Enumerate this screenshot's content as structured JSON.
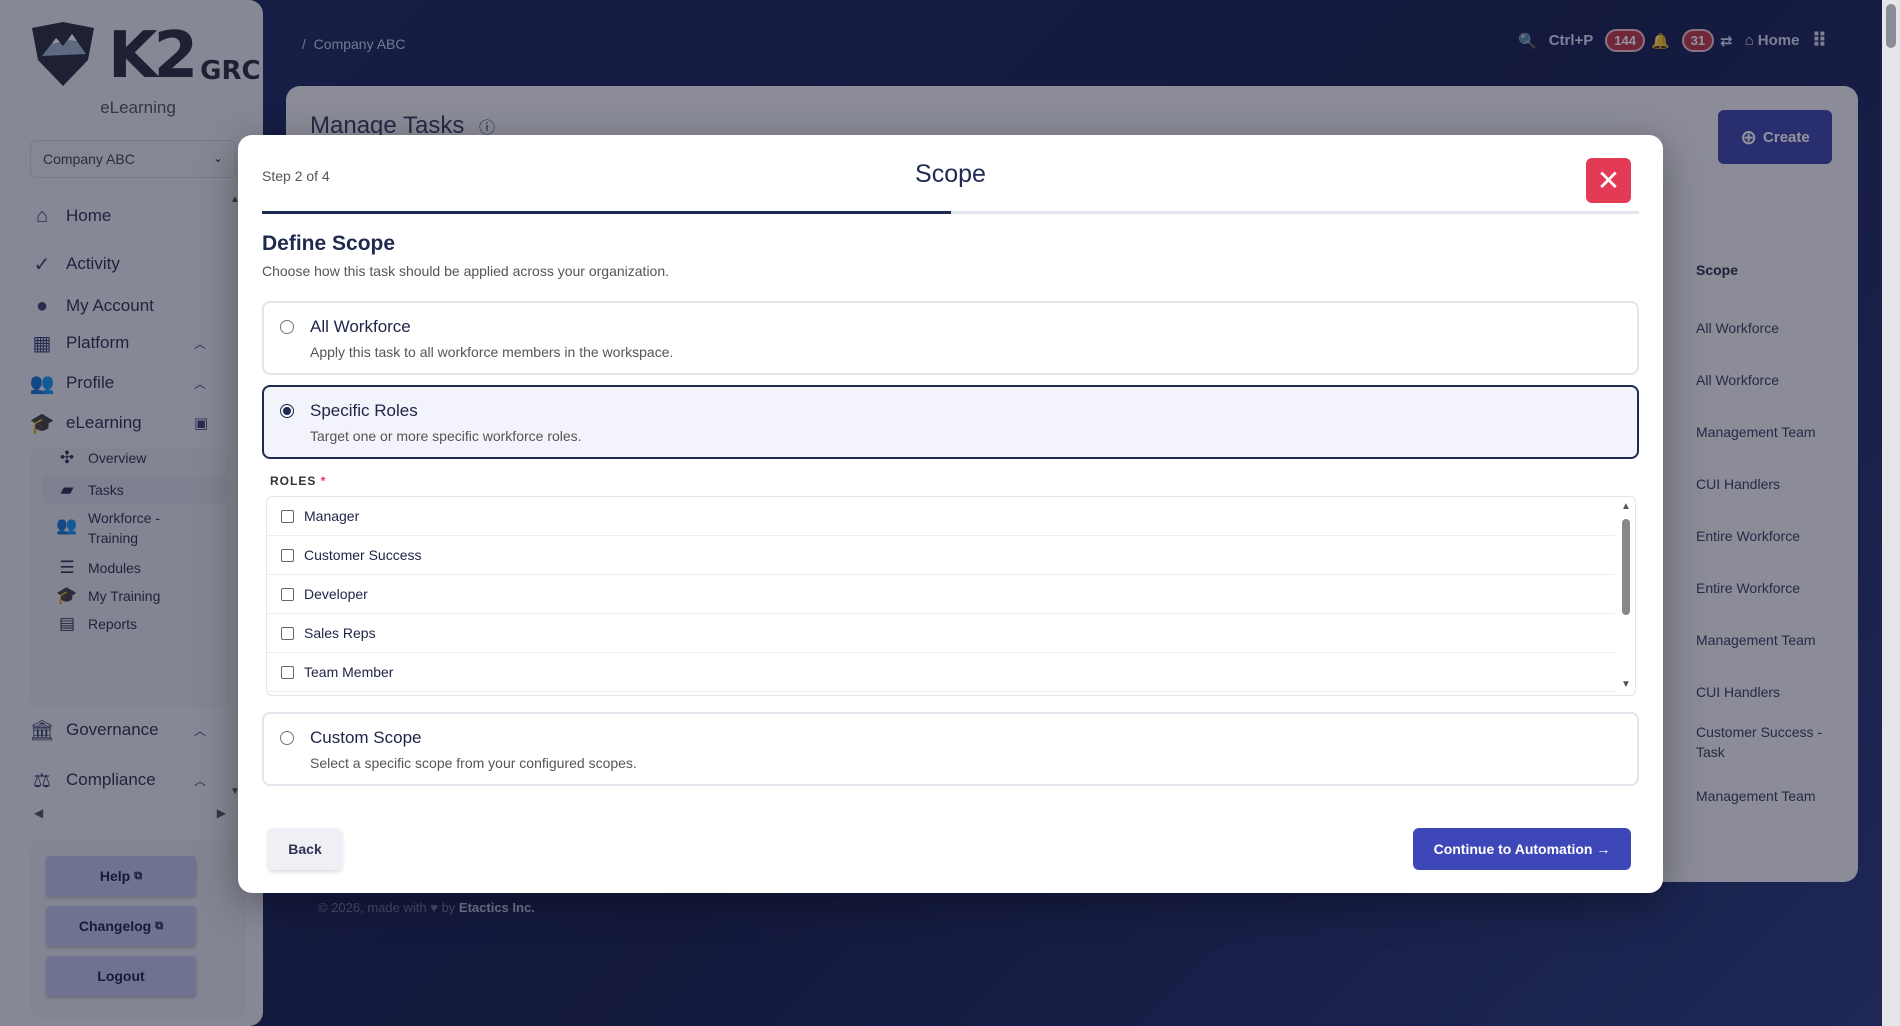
{
  "app": {
    "logo_text": "K2",
    "logo_suffix": "GRC",
    "subtitle": "eLearning"
  },
  "company_select": {
    "value": "Company ABC"
  },
  "sidebar": {
    "items": [
      {
        "label": "Home"
      },
      {
        "label": "Activity"
      },
      {
        "label": "My Account"
      },
      {
        "label": "Platform"
      },
      {
        "label": "Profile"
      },
      {
        "label": "eLearning"
      },
      {
        "label": "Governance"
      },
      {
        "label": "Compliance"
      }
    ],
    "elearning_sub": [
      {
        "label": "Overview"
      },
      {
        "label": "Tasks"
      },
      {
        "label": "Workforce -"
      },
      {
        "label": "Training"
      },
      {
        "label": "Modules"
      },
      {
        "label": "My Training"
      },
      {
        "label": "Reports"
      }
    ],
    "footer": {
      "help": "Help",
      "changelog": "Changelog",
      "logout": "Logout"
    }
  },
  "breadcrumb": {
    "sep": "/",
    "current": "Company ABC"
  },
  "topbar": {
    "search_hint": "Ctrl+P",
    "notifications": "144",
    "tasks": "31",
    "home": "Home"
  },
  "page": {
    "title": "Manage Tasks",
    "create_label": "Create",
    "scope_header": "Scope",
    "scope_rows": [
      "All Workforce",
      "All Workforce",
      "Management Team",
      "CUI Handlers",
      "Entire Workforce",
      "Entire Workforce",
      "Management Team",
      "CUI Handlers",
      "Customer Success - Task",
      "Management Team"
    ],
    "copyright": "© 2026, made with",
    "copyright_by": "by",
    "company": "Etactics Inc."
  },
  "modal": {
    "step": "Step 2 of 4",
    "title": "Scope",
    "progress": 0.5,
    "section_title": "Define Scope",
    "section_sub": "Choose how this task should be applied across your organization.",
    "options": [
      {
        "label": "All Workforce",
        "desc": "Apply this task to all workforce members in the workspace.",
        "selected": false
      },
      {
        "label": "Specific Roles",
        "desc": "Target one or more specific workforce roles.",
        "selected": true
      },
      {
        "label": "Custom Scope",
        "desc": "Select a specific scope from your configured scopes.",
        "selected": false
      }
    ],
    "roles_label": "ROLES",
    "roles_required": "*",
    "roles": [
      "Manager",
      "Customer Success",
      "Developer",
      "Sales Reps",
      "Team Member"
    ],
    "back_label": "Back",
    "continue_label": "Continue to Automation →"
  },
  "colors": {
    "accent": "#3e47b8",
    "danger": "#e33a55",
    "navy": "#1f2a50"
  }
}
